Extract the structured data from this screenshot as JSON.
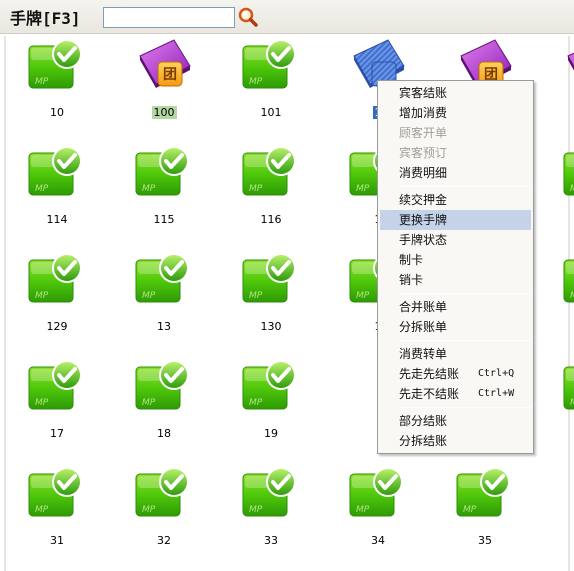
{
  "header": {
    "title": "手牌[F3]",
    "search_value": "",
    "search_icon": "magnifier-icon"
  },
  "tiles": [
    {
      "label": "10",
      "icon": "green-check-card-icon"
    },
    {
      "label": "100",
      "icon": "purple-group-card-icon"
    },
    {
      "label": "101",
      "icon": "green-check-card-icon"
    },
    {
      "label": "1",
      "icon": "blue-striped-card-icon"
    },
    {
      "label": "",
      "icon": "purple-group-card-icon"
    },
    {
      "label": "114",
      "icon": "green-check-card-icon"
    },
    {
      "label": "115",
      "icon": "green-check-card-icon"
    },
    {
      "label": "116",
      "icon": "green-check-card-icon"
    },
    {
      "label": "1",
      "icon": "green-check-card-icon"
    },
    {
      "label": "129",
      "icon": "green-check-card-icon"
    },
    {
      "label": "13",
      "icon": "green-check-card-icon"
    },
    {
      "label": "130",
      "icon": "green-check-card-icon"
    },
    {
      "label": "1",
      "icon": "green-check-card-icon"
    },
    {
      "label": "17",
      "icon": "green-check-card-icon"
    },
    {
      "label": "18",
      "icon": "green-check-card-icon"
    },
    {
      "label": "19",
      "icon": "green-check-card-icon"
    },
    {
      "label": "31",
      "icon": "green-check-card-icon"
    },
    {
      "label": "32",
      "icon": "green-check-card-icon"
    },
    {
      "label": "33",
      "icon": "green-check-card-icon"
    },
    {
      "label": "34",
      "icon": "green-check-card-icon"
    },
    {
      "label": "35",
      "icon": "green-check-card-icon"
    }
  ],
  "menu": {
    "items": [
      {
        "label": "宾客结账",
        "state": "enabled",
        "shortcut": ""
      },
      {
        "label": "增加消费",
        "state": "enabled",
        "shortcut": ""
      },
      {
        "label": "顾客开单",
        "state": "disabled",
        "shortcut": ""
      },
      {
        "label": "宾客预订",
        "state": "disabled",
        "shortcut": ""
      },
      {
        "label": "消费明细",
        "state": "enabled",
        "shortcut": ""
      },
      {
        "label": "续交押金",
        "state": "enabled",
        "shortcut": ""
      },
      {
        "label": "更换手牌",
        "state": "hover",
        "shortcut": ""
      },
      {
        "label": "手牌状态",
        "state": "enabled",
        "shortcut": ""
      },
      {
        "label": "制卡",
        "state": "enabled",
        "shortcut": ""
      },
      {
        "label": "销卡",
        "state": "enabled",
        "shortcut": ""
      },
      {
        "label": "合并账单",
        "state": "enabled",
        "shortcut": ""
      },
      {
        "label": "分拆账单",
        "state": "enabled",
        "shortcut": ""
      },
      {
        "label": "消费转单",
        "state": "enabled",
        "shortcut": ""
      },
      {
        "label": "先走先结账",
        "state": "enabled",
        "shortcut": "Ctrl+Q"
      },
      {
        "label": "先走不结账",
        "state": "enabled",
        "shortcut": "Ctrl+W"
      },
      {
        "label": "部分结账",
        "state": "enabled",
        "shortcut": ""
      },
      {
        "label": "分拆结账",
        "state": "enabled",
        "shortcut": ""
      }
    ]
  }
}
